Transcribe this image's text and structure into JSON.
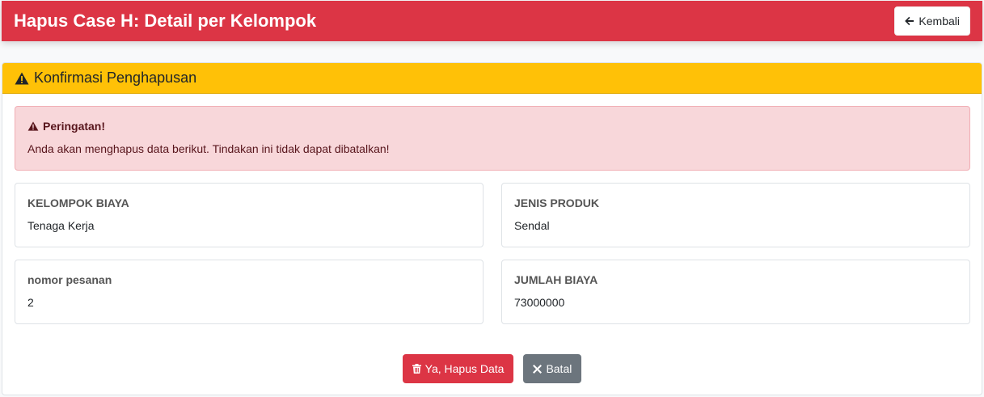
{
  "header": {
    "title": "Hapus Case H: Detail per Kelompok",
    "back_label": "Kembali"
  },
  "card": {
    "title": "Konfirmasi Penghapusan"
  },
  "alert": {
    "title": "Peringatan!",
    "message": "Anda akan menghapus data berikut. Tindakan ini tidak dapat dibatalkan!"
  },
  "fields": [
    {
      "label": "KELOMPOK BIAYA",
      "value": "Tenaga Kerja"
    },
    {
      "label": "JENIS PRODUK",
      "value": "Sendal"
    },
    {
      "label": "nomor pesanan",
      "value": "2"
    },
    {
      "label": "JUMLAH BIAYA",
      "value": "73000000"
    }
  ],
  "actions": {
    "delete_label": "Ya, Hapus Data",
    "cancel_label": "Batal"
  },
  "colors": {
    "primary_danger": "#dc3545",
    "warning": "#ffc107",
    "secondary": "#6c757d"
  },
  "icons": {
    "back": "arrow-left-icon",
    "warning": "warning-triangle-icon",
    "delete": "trash-icon",
    "cancel": "times-icon"
  }
}
